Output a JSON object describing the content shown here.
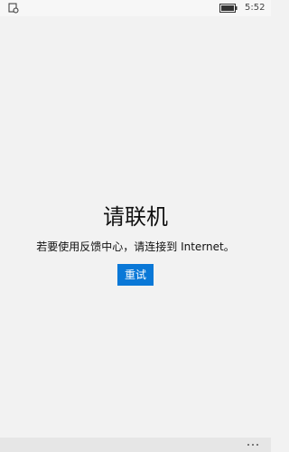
{
  "status_bar": {
    "left_icon": "notification-icon",
    "battery_icon": "battery-icon",
    "time": "5:52"
  },
  "main": {
    "title": "请联机",
    "message": "若要使用反馈中心，请连接到 Internet。",
    "retry_label": "重试",
    "retry_color": "#0a78d7"
  },
  "bottom_bar": {
    "more_icon": "more-icon"
  }
}
